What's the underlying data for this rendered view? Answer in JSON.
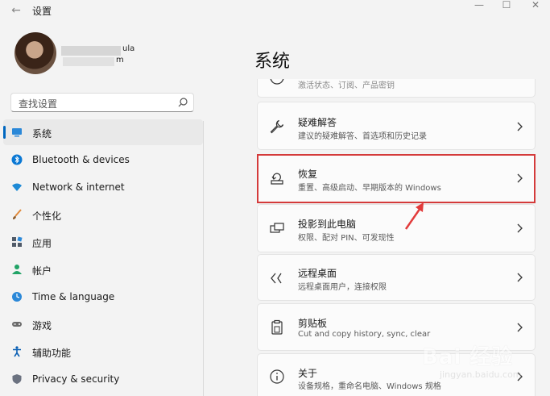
{
  "window": {
    "title": "设置",
    "back_glyph": "←",
    "minimize_glyph": "—",
    "maximize_glyph": "☐",
    "close_glyph": "✕"
  },
  "user": {
    "name_fragment": "ula",
    "email_fragment": "m"
  },
  "search": {
    "placeholder": "查找设置"
  },
  "sidebar": {
    "items": [
      {
        "label": "系统",
        "icon": "system-icon",
        "selected": true
      },
      {
        "label": "Bluetooth & devices",
        "icon": "bluetooth-icon"
      },
      {
        "label": "Network & internet",
        "icon": "network-icon"
      },
      {
        "label": "个性化",
        "icon": "personalization-brush-icon"
      },
      {
        "label": "应用",
        "icon": "apps-icon"
      },
      {
        "label": "帐户",
        "icon": "account-icon"
      },
      {
        "label": "Time & language",
        "icon": "time-language-icon"
      },
      {
        "label": "游戏",
        "icon": "gaming-icon"
      },
      {
        "label": "辅助功能",
        "icon": "accessibility-icon"
      },
      {
        "label": "Privacy & security",
        "icon": "shield-icon"
      }
    ]
  },
  "main": {
    "title": "系统",
    "cards": [
      {
        "title": "",
        "subtitle": "激活状态、订阅、产品密钥",
        "icon": "activation-icon"
      },
      {
        "title": "疑难解答",
        "subtitle": "建议的疑难解答、首选项和历史记录",
        "icon": "wrench-icon"
      },
      {
        "title": "恢复",
        "subtitle": "重置、高级启动、早期版本的 Windows",
        "icon": "recovery-icon"
      },
      {
        "title": "投影到此电脑",
        "subtitle": "权限、配对 PIN、可发现性",
        "icon": "project-icon"
      },
      {
        "title": "远程桌面",
        "subtitle": "远程桌面用户，连接权限",
        "icon": "remote-desktop-icon"
      },
      {
        "title": "剪贴板",
        "subtitle": "Cut and copy history, sync, clear",
        "icon": "clipboard-icon"
      },
      {
        "title": "关于",
        "subtitle": "设备规格，重命名电脑、Windows 规格",
        "icon": "info-icon"
      }
    ]
  },
  "watermark": {
    "line1": "Bai 经验",
    "line2": "jingyan.baidu.com"
  },
  "colors": {
    "accent": "#0067c0",
    "highlight": "#d43a3a",
    "background": "#f3f3f3"
  }
}
